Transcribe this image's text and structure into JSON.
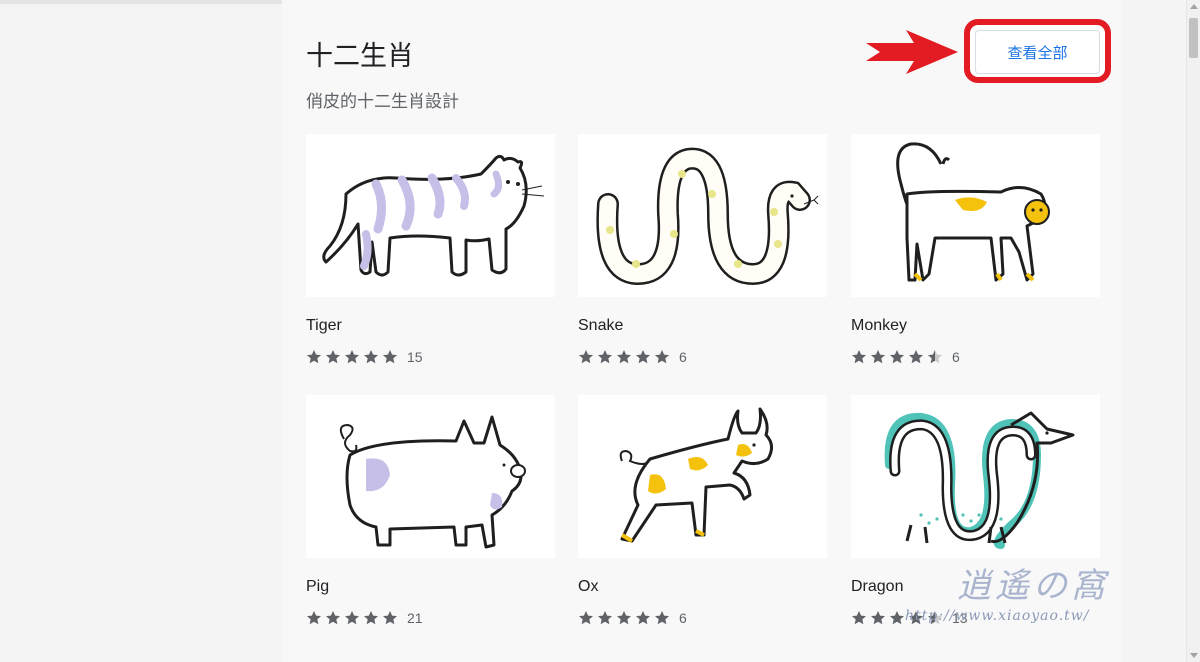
{
  "section": {
    "title": "十二生肖",
    "subtitle": "俏皮的十二生肖設計",
    "view_all_label": "查看全部"
  },
  "cards": [
    {
      "name": "Tiger",
      "rating": 5,
      "count": "15",
      "icon": "tiger-illustration"
    },
    {
      "name": "Snake",
      "rating": 5,
      "count": "6",
      "icon": "snake-illustration"
    },
    {
      "name": "Monkey",
      "rating": 4.5,
      "count": "6",
      "icon": "monkey-illustration"
    },
    {
      "name": "Pig",
      "rating": 5,
      "count": "21",
      "icon": "pig-illustration"
    },
    {
      "name": "Ox",
      "rating": 5,
      "count": "6",
      "icon": "ox-illustration"
    },
    {
      "name": "Dragon",
      "rating": 4.5,
      "count": "13",
      "icon": "dragon-illustration"
    }
  ],
  "watermark": {
    "title": "逍遙の窩",
    "url": "http://www.xiaoyao.tw/"
  },
  "colors": {
    "accent": "#1a73e8",
    "highlight": "#e31b23",
    "star": "#5f6368",
    "lavender": "#c6c0e8",
    "yellow": "#f4c20d",
    "teal": "#4fc3b8"
  }
}
